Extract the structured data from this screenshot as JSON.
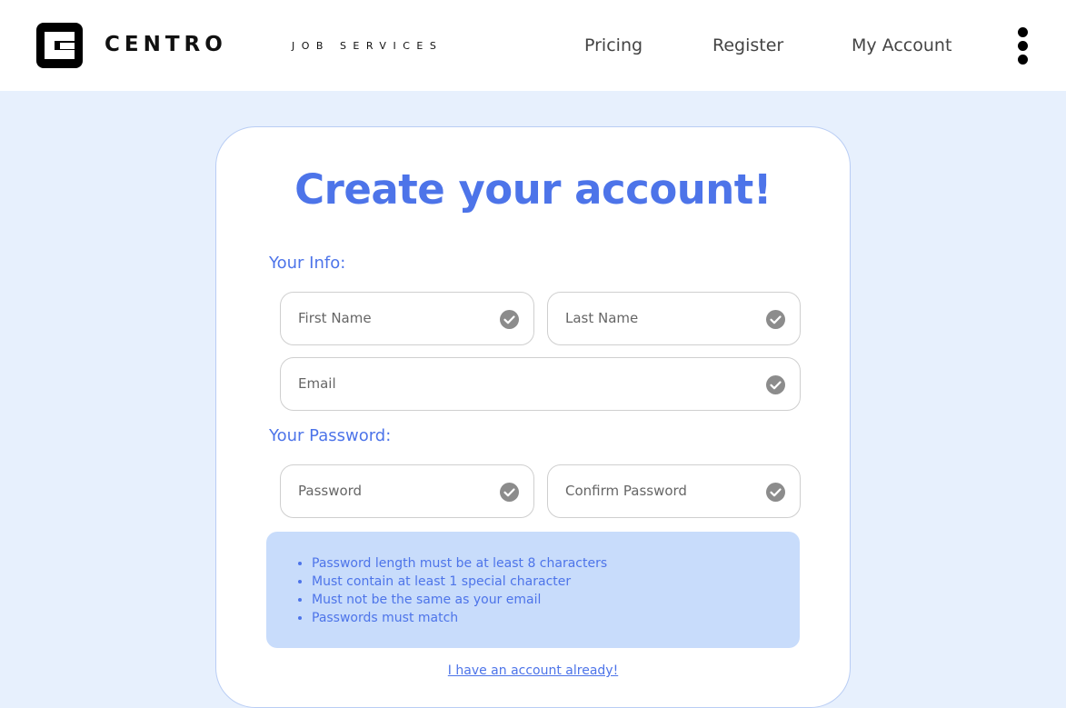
{
  "header": {
    "brand": "CENTRO",
    "tagline": "JOB SERVICES",
    "nav": {
      "pricing": "Pricing",
      "register": "Register",
      "account": "My Account"
    }
  },
  "form": {
    "title": "Create your account!",
    "info_label": "Your Info:",
    "password_label": "Your Password:",
    "fields": {
      "first_name": "First Name",
      "last_name": "Last Name",
      "email": "Email",
      "password": "Password",
      "confirm_password": "Confirm Password"
    },
    "rules": [
      "Password length must be at least 8 characters",
      "Must contain at least 1 special character",
      "Must not be the same as your email",
      "Passwords must match"
    ],
    "login_link": "I have an account already!"
  },
  "colors": {
    "accent": "#4d74e9",
    "page_bg": "#e7f0fd",
    "rules_bg": "#c8dcfb",
    "check_icon": "#8c8c8c"
  }
}
